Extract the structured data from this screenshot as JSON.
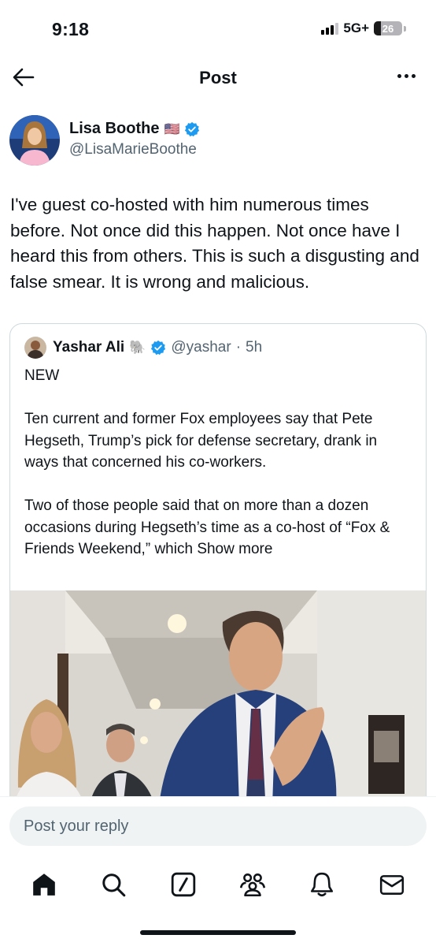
{
  "status_bar": {
    "time": "9:18",
    "network": "5G+",
    "battery_level": "26",
    "battery_fraction": 0.26
  },
  "header": {
    "title": "Post",
    "back_icon": "arrow-left-icon",
    "more_icon": "more-horizontal-icon"
  },
  "author": {
    "name": "Lisa Boothe",
    "flag": "🇺🇸",
    "handle": "@LisaMarieBoothe",
    "verified": true
  },
  "post": {
    "text": "I've guest co-hosted with him numerous times before. Not once did this happen. Not once have I heard this from others. This is such a disgusting and false smear. It is wrong and malicious."
  },
  "quote": {
    "name": "Yashar Ali",
    "emoji": "🐘",
    "handle": "@yashar",
    "separator": "·",
    "time": "5h",
    "verified": true,
    "para1": "NEW",
    "para2": "Ten current and former Fox employees say that Pete Hegseth, Trump’s pick for defense secretary, drank in ways that concerned his co-workers.",
    "para3": "Two of those people said that on more than a dozen occasions during Hegseth’s time as a co-host of “Fox & Friends Weekend,” which",
    "show_more": "Show more"
  },
  "reply": {
    "placeholder": "Post your reply"
  },
  "tabbar": {
    "items": [
      {
        "icon": "home-icon"
      },
      {
        "icon": "search-icon"
      },
      {
        "icon": "grok-icon"
      },
      {
        "icon": "communities-icon"
      },
      {
        "icon": "notifications-bell-icon"
      },
      {
        "icon": "messages-envelope-icon"
      }
    ]
  },
  "colors": {
    "verified_blue": "#1d9bf0",
    "text_primary": "#0f1419",
    "text_secondary": "#536471",
    "border": "#cfd9de"
  }
}
